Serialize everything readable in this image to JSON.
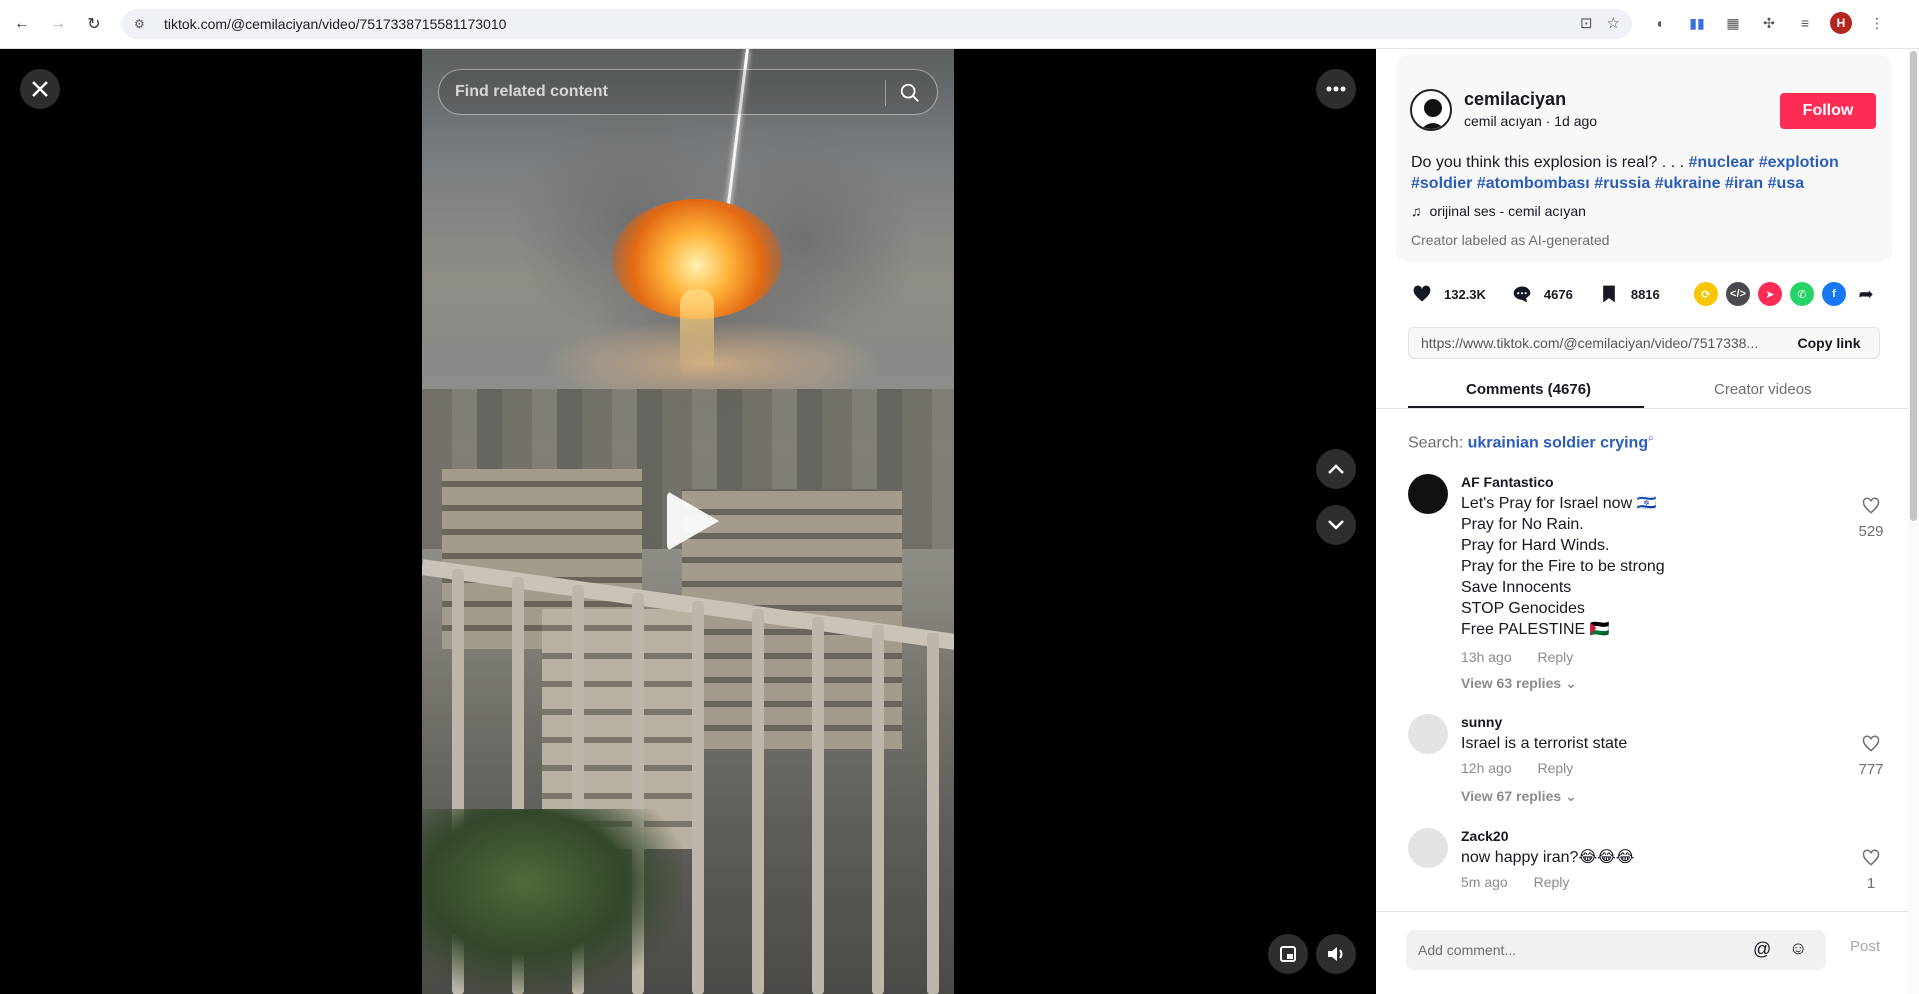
{
  "browser": {
    "url": "tiktok.com/@cemilaciyan/video/7517338715581173010",
    "profile_initial": "H"
  },
  "video": {
    "search_placeholder": "Find related content"
  },
  "author": {
    "username": "cemilaciyan",
    "subline": "cemil acıyan · 1d ago",
    "follow_label": "Follow"
  },
  "description": {
    "text": "Do you think this explosion is real? . . . ",
    "hashtags": [
      "#nuclear",
      "#explotion",
      "#soldier",
      "#atombombası",
      "#russia",
      "#ukraine",
      "#iran",
      "#usa"
    ]
  },
  "music": "orijinal ses - cemil acıyan",
  "ai_label": "Creator labeled as AI-generated",
  "stats": {
    "likes": "132.3K",
    "comments": "4676",
    "saves": "8816"
  },
  "share_colors": {
    "repost": "#f7c600",
    "embed": "#4a4a4f",
    "send": "#fe2c55",
    "whatsapp": "#25d366",
    "facebook": "#1877f2"
  },
  "copy_link": {
    "url": "https://www.tiktok.com/@cemilaciyan/video/7517338...",
    "label": "Copy link"
  },
  "tabs": {
    "comments": "Comments (4676)",
    "creator_videos": "Creator videos"
  },
  "search_hint": {
    "prefix": "Search:",
    "keyword": "ukrainian soldier crying"
  },
  "comments": [
    {
      "user": "AF Fantastico",
      "text": "Let's Pray for Israel now 🇮🇱\nPray for No Rain.\nPray for Hard Winds.\nPray for the Fire to be strong\nSave Innocents\nSTOP Genocides\nFree PALESTINE 🇵🇸",
      "time": "13h ago",
      "reply": "Reply",
      "likes": "529",
      "view_replies": "View 63 replies ⌄"
    },
    {
      "user": "sunny",
      "text": "Israel is a terrorist state",
      "time": "12h ago",
      "reply": "Reply",
      "likes": "777",
      "view_replies": "View 67 replies ⌄"
    },
    {
      "user": "Zack20",
      "text": "now happy iran?😂😂😂",
      "time": "5m ago",
      "reply": "Reply",
      "likes": "1"
    }
  ],
  "comment_bar": {
    "placeholder": "Add comment...",
    "post_label": "Post"
  }
}
